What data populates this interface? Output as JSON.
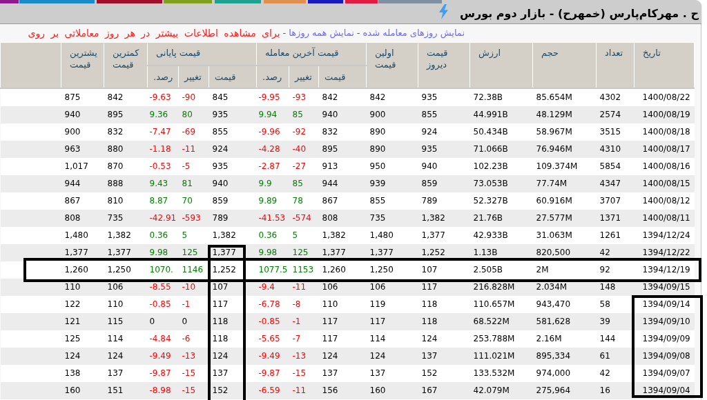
{
  "top_tabs": [
    {
      "color": "#8c1a8c"
    },
    {
      "color": "#1a8ac8"
    },
    {
      "color": "#a0102a"
    },
    {
      "color": "#80a020"
    },
    {
      "color": "#20a090"
    },
    {
      "color": "#e09050"
    },
    {
      "color": "#1a1ac0"
    },
    {
      "color": "#e01a40"
    },
    {
      "color": "#8090a0"
    }
  ],
  "window": {
    "title": "ح . مهرکام‌پارس (خمهرح) - بازار دوم بورس"
  },
  "links_bar": [
    {
      "kind": "link",
      "text": "نمایش روزهای معامله شده"
    },
    {
      "kind": "separator",
      "text": "-"
    },
    {
      "kind": "link",
      "text": "نمایش همه روزها"
    },
    {
      "kind": "separator",
      "text": "-"
    },
    {
      "kind": "note",
      "text": "برای مشاهده اطلاعات بیشتر در هر روز معاملاتی بر روی"
    }
  ],
  "table": {
    "columns": [
      {
        "label": "تاریخ"
      },
      {
        "label": "تعداد"
      },
      {
        "label": "حجم"
      },
      {
        "label": "ارزش"
      },
      {
        "label": "قیمت دیروز"
      },
      {
        "label": "اولین قیمت"
      },
      {
        "label": "قیمت آخرین معامله",
        "children": [
          {
            "label": "قیمت"
          },
          {
            "label": "تغییر"
          },
          {
            "label": "رصد."
          }
        ]
      },
      {
        "label": "قیمت پایانی",
        "children": [
          {
            "label": "قیمت"
          },
          {
            "label": "تغییر"
          },
          {
            "label": "رصد."
          }
        ]
      },
      {
        "label": "کمترین قیمت"
      },
      {
        "label": "یشترین قیمت"
      }
    ],
    "rows": [
      {
        "date": "1400/08/22",
        "trades": "4302",
        "volume": "85.654M",
        "value": "72.38B",
        "yesterday": "935",
        "first": "842",
        "last": {
          "price": "842",
          "change": "-93",
          "percent": "-9.95",
          "color": "#ff0000"
        },
        "close": {
          "price": "845",
          "change": "-90",
          "percent": "-9.63",
          "color": "#ff0000"
        },
        "low": "842",
        "high": "875"
      },
      {
        "date": "1400/08/19",
        "trades": "2574",
        "volume": "48.129M",
        "value": "44.991B",
        "yesterday": "855",
        "first": "900",
        "last": {
          "price": "940",
          "change": "85",
          "percent": "9.94",
          "color": "#008000"
        },
        "close": {
          "price": "935",
          "change": "80",
          "percent": "9.36",
          "color": "#008000"
        },
        "low": "895",
        "high": "940"
      },
      {
        "date": "1400/08/18",
        "trades": "3515",
        "volume": "58.967M",
        "value": "50.434B",
        "yesterday": "924",
        "first": "890",
        "last": {
          "price": "832",
          "change": "-92",
          "percent": "-9.96",
          "color": "#ff0000"
        },
        "close": {
          "price": "855",
          "change": "-69",
          "percent": "-7.47",
          "color": "#ff0000"
        },
        "low": "832",
        "high": "900"
      },
      {
        "date": "1400/08/17",
        "trades": "4310",
        "volume": "76.946M",
        "value": "71.066B",
        "yesterday": "935",
        "first": "890",
        "last": {
          "price": "895",
          "change": "-40",
          "percent": "-4.28",
          "color": "#ff0000"
        },
        "close": {
          "price": "924",
          "change": "-11",
          "percent": "-1.18",
          "color": "#ff0000"
        },
        "low": "880",
        "high": "963"
      },
      {
        "date": "1400/08/16",
        "trades": "5854",
        "volume": "109.374M",
        "value": "102.23B",
        "yesterday": "940",
        "first": "950",
        "last": {
          "price": "913",
          "change": "-27",
          "percent": "-2.87",
          "color": "#ff0000"
        },
        "close": {
          "price": "935",
          "change": "-5",
          "percent": "-0.53",
          "color": "#ff0000"
        },
        "low": "870",
        "high": "1,017"
      },
      {
        "date": "1400/08/15",
        "trades": "4347",
        "volume": "77.74M",
        "value": "73.053B",
        "yesterday": "859",
        "first": "939",
        "last": {
          "price": "944",
          "change": "85",
          "percent": "9.9",
          "color": "#008000"
        },
        "close": {
          "price": "940",
          "change": "81",
          "percent": "9.43",
          "color": "#008000"
        },
        "low": "888",
        "high": "944"
      },
      {
        "date": "1400/08/12",
        "trades": "3707",
        "volume": "60.916M",
        "value": "52.327B",
        "yesterday": "789",
        "first": "855",
        "last": {
          "price": "867",
          "change": "78",
          "percent": "9.89",
          "color": "#008000"
        },
        "close": {
          "price": "859",
          "change": "70",
          "percent": "8.87",
          "color": "#008000"
        },
        "low": "810",
        "high": "867"
      },
      {
        "date": "1400/08/11",
        "trades": "1371",
        "volume": "27.577M",
        "value": "21.76B",
        "yesterday": "1,382",
        "first": "735",
        "last": {
          "price": "808",
          "change": "-574",
          "percent": "-41.53",
          "color": "#ff0000"
        },
        "close": {
          "price": "789",
          "change": "-593",
          "percent": "-42.91",
          "color": "#ff0000"
        },
        "low": "735",
        "high": "808"
      },
      {
        "date": "1394/12/24",
        "trades": "1261",
        "volume": "31.063M",
        "value": "42.933B",
        "yesterday": "1,377",
        "first": "1,480",
        "last": {
          "price": "1,382",
          "change": "5",
          "percent": "0.36",
          "color": "#008000"
        },
        "close": {
          "price": "1,382",
          "change": "5",
          "percent": "0.36",
          "color": "#008000"
        },
        "low": "1,382",
        "high": "1,480"
      },
      {
        "date": "1394/12/22",
        "trades": "42",
        "volume": "820,500",
        "value": "1.13B",
        "yesterday": "1,252",
        "first": "1,377",
        "last": {
          "price": "1,377",
          "change": "125",
          "percent": "9.98",
          "color": "#008000"
        },
        "close": {
          "price": "1,377",
          "change": "125",
          "percent": "9.98",
          "color": "#008000"
        },
        "low": "1,377",
        "high": "1,377"
      },
      {
        "date": "1394/12/19",
        "trades": "92",
        "volume": "2M",
        "value": "2.505B",
        "yesterday": "107",
        "first": "1,250",
        "last": {
          "price": "1,260",
          "change": "1153",
          "percent": "1077.5",
          "color": "#008000"
        },
        "close": {
          "price": "1,252",
          "change": "1146",
          "percent": "1070.",
          "color": "#008000"
        },
        "low": "1,250",
        "high": "1,260"
      },
      {
        "date": "1394/09/15",
        "trades": "148",
        "volume": "2.034M",
        "value": "216.828M",
        "yesterday": "117",
        "first": "106",
        "last": {
          "price": "106",
          "change": "-11",
          "percent": "-9.4",
          "color": "#ff0000"
        },
        "close": {
          "price": "107",
          "change": "-10",
          "percent": "-8.55",
          "color": "#ff0000"
        },
        "low": "106",
        "high": "110"
      },
      {
        "date": "1394/09/14",
        "trades": "58",
        "volume": "943,470",
        "value": "110.657M",
        "yesterday": "118",
        "first": "119",
        "last": {
          "price": "110",
          "change": "-8",
          "percent": "-6.78",
          "color": "#ff0000"
        },
        "close": {
          "price": "117",
          "change": "-1",
          "percent": "-0.85",
          "color": "#ff0000"
        },
        "low": "110",
        "high": "122"
      },
      {
        "date": "1394/09/10",
        "trades": "39",
        "volume": "581,628",
        "value": "68.522M",
        "yesterday": "118",
        "first": "117",
        "last": {
          "price": "117",
          "change": "-1",
          "percent": "-0.85",
          "color": "#ff0000"
        },
        "close": {
          "price": "118",
          "change": "0",
          "percent": "0"
        },
        "low": "115",
        "high": "121"
      },
      {
        "date": "1394/09/09",
        "trades": "144",
        "volume": "2.16M",
        "value": "253.788M",
        "yesterday": "124",
        "first": "114",
        "last": {
          "price": "117",
          "change": "-7",
          "percent": "-5.65",
          "color": "#ff0000"
        },
        "close": {
          "price": "118",
          "change": "-6",
          "percent": "-4.84",
          "color": "#ff0000"
        },
        "low": "114",
        "high": "125"
      },
      {
        "date": "1394/09/08",
        "trades": "61",
        "volume": "895,334",
        "value": "111.021M",
        "yesterday": "137",
        "first": "124",
        "last": {
          "price": "124",
          "change": "-13",
          "percent": "-9.49",
          "color": "#ff0000"
        },
        "close": {
          "price": "124",
          "change": "-13",
          "percent": "-9.49",
          "color": "#ff0000"
        },
        "low": "124",
        "high": "124"
      },
      {
        "date": "1394/09/07",
        "trades": "42",
        "volume": "974,000",
        "value": "133.532M",
        "yesterday": "152",
        "first": "137",
        "last": {
          "price": "137",
          "change": "-15",
          "percent": "-9.87",
          "color": "#ff0000"
        },
        "close": {
          "price": "137",
          "change": "-15",
          "percent": "-9.87",
          "color": "#ff0000"
        },
        "low": "137",
        "high": "138"
      },
      {
        "date": "1394/09/04",
        "trades": "16",
        "volume": "275,964",
        "value": "42.079M",
        "yesterday": "167",
        "first": "160",
        "last": {
          "price": "156",
          "change": "-11",
          "percent": "-6.59",
          "color": "#ff0000"
        },
        "close": {
          "price": "152",
          "change": "-15",
          "percent": "-8.98",
          "color": "#ff0000"
        },
        "low": "151",
        "high": "160"
      }
    ]
  },
  "annotation_frames": [
    {
      "kind": "row"
    },
    {
      "kind": "column"
    },
    {
      "kind": "date_cells"
    }
  ]
}
